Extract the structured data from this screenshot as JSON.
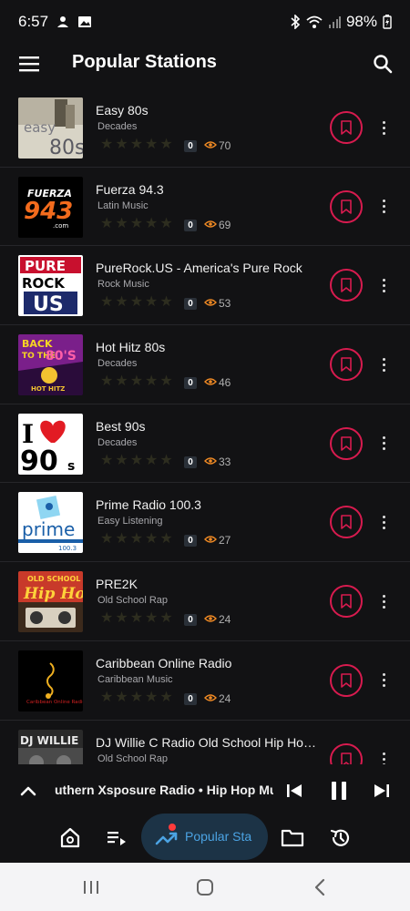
{
  "status_bar": {
    "time": "6:57",
    "battery": "98%"
  },
  "app_bar": {
    "title": "Popular Stations"
  },
  "stations": [
    {
      "name": "Easy 80s",
      "genre": "Decades",
      "rating": "0",
      "views": "70",
      "logo_text": "easy 80s"
    },
    {
      "name": "Fuerza 94.3",
      "genre": "Latin Music",
      "rating": "0",
      "views": "69",
      "logo_text": "FUERZA 943 .com"
    },
    {
      "name": "PureRock.US - America's Pure Rock",
      "genre": "Rock Music",
      "rating": "0",
      "views": "53",
      "logo_text": "PURE ROCK US"
    },
    {
      "name": "Hot Hitz 80s",
      "genre": "Decades",
      "rating": "0",
      "views": "46",
      "logo_text": "BACK TO THE 80'S HOT HITZ"
    },
    {
      "name": "Best 90s",
      "genre": "Decades",
      "rating": "0",
      "views": "33",
      "logo_text": "I 90s"
    },
    {
      "name": "Prime Radio 100.3",
      "genre": "Easy Listening",
      "rating": "0",
      "views": "27",
      "logo_text": "prime 100.3"
    },
    {
      "name": "PRE2K",
      "genre": "Old School Rap",
      "rating": "0",
      "views": "24",
      "logo_text": "OLD SCHOOL Hip Hop"
    },
    {
      "name": "Caribbean Online Radio",
      "genre": "Caribbean Music",
      "rating": "0",
      "views": "24",
      "logo_text": "Caribbean Online Radio"
    },
    {
      "name": "DJ Willie C Radio Old School Hip Hop Rn...",
      "genre": "Old School Rap",
      "rating": "",
      "views": "",
      "logo_text": "DJ WILLIE C"
    }
  ],
  "player": {
    "now_playing": "uthern Xsposure Radio • Hip Hop Music"
  },
  "bottom_nav": {
    "active_label": "Popular Sta"
  },
  "colors": {
    "background": "#121214",
    "accent_pink": "#d81b4f",
    "accent_blue": "#4ba3e3",
    "views_icon": "#f08a24"
  }
}
